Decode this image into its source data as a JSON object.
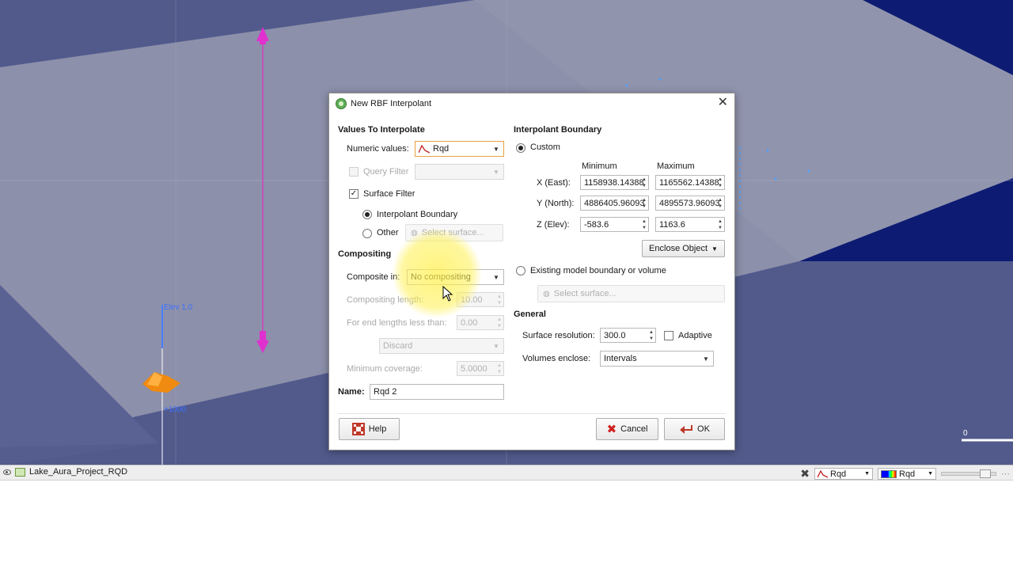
{
  "scene": {
    "elev_label": "Elev 1.0",
    "elev_marker": "+1000",
    "axis_zero": "0"
  },
  "statusbar": {
    "project_name": "Lake_Aura_Project_RQD",
    "rqd_select_1": "Rqd",
    "rqd_select_2": "Rqd"
  },
  "dialog": {
    "title": "New RBF Interpolant",
    "values_section": "Values To Interpolate",
    "numeric_values_label": "Numeric values:",
    "numeric_values_value": "Rqd",
    "query_filter_label": "Query Filter",
    "surface_filter_label": "Surface Filter",
    "surface_filter_checked": true,
    "interp_boundary_option": "Interpolant Boundary",
    "other_option": "Other",
    "select_surface_placeholder": "Select surface...",
    "compositing_section": "Compositing",
    "composite_in_label": "Composite in:",
    "composite_in_value": "No compositing",
    "compositing_length_label": "Compositing length:",
    "compositing_length_value": "10.00",
    "end_lengths_label": "For end lengths less than:",
    "end_lengths_value": "0.00",
    "discard_value": "Discard",
    "min_coverage_label": "Minimum coverage:",
    "min_coverage_value": "5.0000",
    "name_label": "Name:",
    "name_value": "Rqd 2",
    "boundary_section": "Interpolant Boundary",
    "custom_option": "Custom",
    "minimum_header": "Minimum",
    "maximum_header": "Maximum",
    "x_label": "X (East):",
    "x_min": "1158938.14388",
    "x_max": "1165562.14388",
    "y_label": "Y (North):",
    "y_min": "4886405.96093",
    "y_max": "4895573.96093",
    "z_label": "Z (Elev):",
    "z_min": "-583.6",
    "z_max": "1163.6",
    "enclose_object": "Enclose Object",
    "existing_boundary_option": "Existing model boundary or volume",
    "select_surface_placeholder_2": "Select surface...",
    "general_section": "General",
    "surface_resolution_label": "Surface resolution:",
    "surface_resolution_value": "300.0",
    "adaptive_label": "Adaptive",
    "volumes_enclose_label": "Volumes enclose:",
    "volumes_enclose_value": "Intervals",
    "help_button": "Help",
    "cancel_button": "Cancel",
    "ok_button": "OK"
  },
  "colors": {
    "scene_bg": "#4f5688",
    "plane": "#8a8ea8",
    "dark_region": "#0b1a6e",
    "highlight": "#fff050"
  }
}
